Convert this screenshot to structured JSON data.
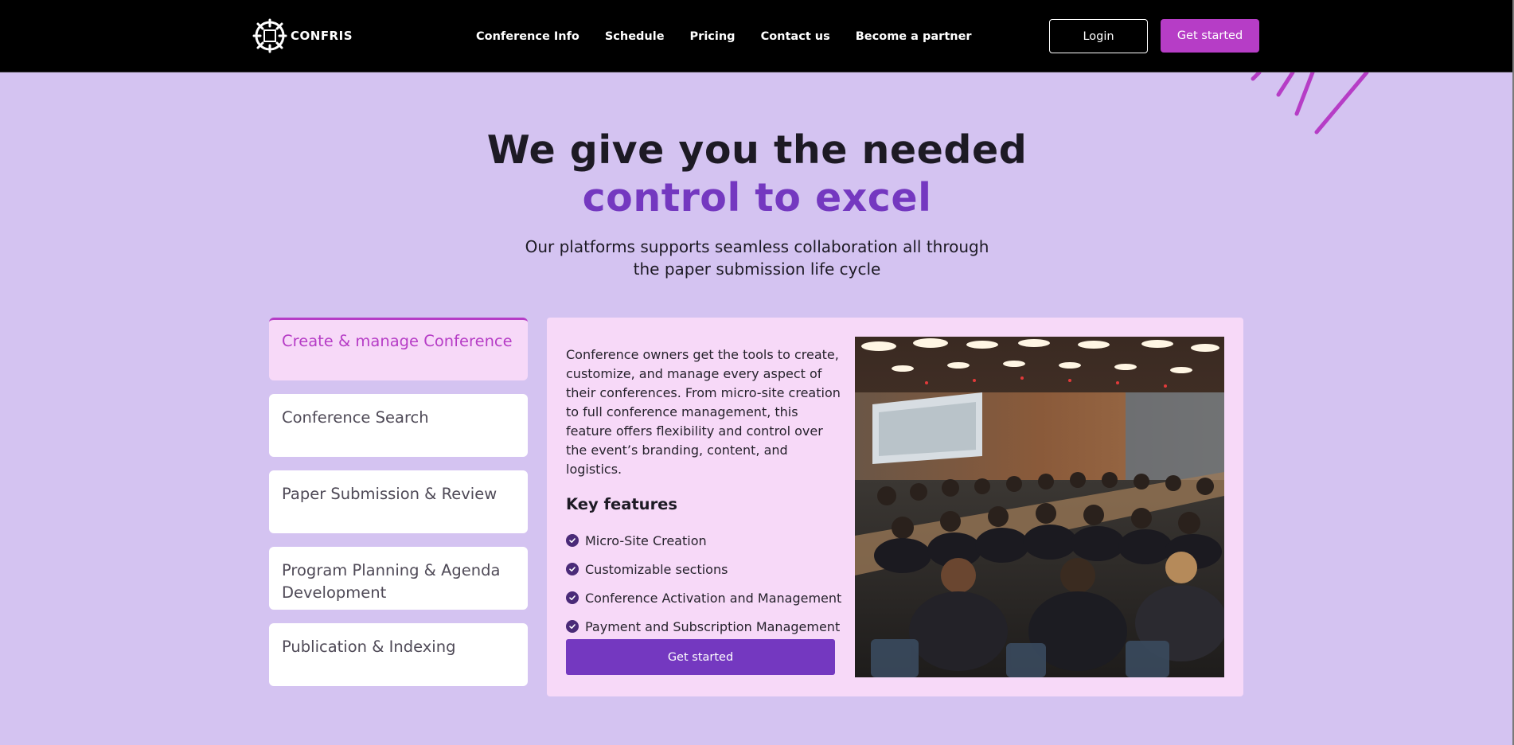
{
  "brand": {
    "logo_text": "CONFRIS"
  },
  "nav": {
    "links": [
      "Conference Info",
      "Schedule",
      "Pricing",
      "Contact us",
      "Become a partner"
    ],
    "login_label": "Login",
    "get_started_label": "Get started"
  },
  "hero": {
    "title_line1": "We give you the needed",
    "title_line2": "control to excel",
    "subtitle": "Our platforms supports seamless collaboration all through the paper submission life cycle"
  },
  "tabs": [
    {
      "label": "Create & manage Conference",
      "active": true
    },
    {
      "label": "Conference Search",
      "active": false
    },
    {
      "label": "Paper Submission & Review",
      "active": false
    },
    {
      "label": "Program Planning & Agenda Development",
      "active": false
    },
    {
      "label": "Publication & Indexing",
      "active": false
    }
  ],
  "panel": {
    "description": "Conference owners get the tools to create, customize, and manage every aspect of their conferences. From micro-site creation to full conference management, this feature offers flexibility and control over the event’s branding, content, and logistics.",
    "features_title": "Key features",
    "features": [
      "Micro-Site Creation",
      "Customizable sections",
      "Conference Activation and Management",
      "Payment and Subscription Management"
    ],
    "button_label": "Get started"
  },
  "colors": {
    "background": "#d4c3f1",
    "navbar": "#000000",
    "accent_magenta": "#b63dc6",
    "accent_purple": "#7438c0",
    "panel": "#f7d9f8"
  }
}
